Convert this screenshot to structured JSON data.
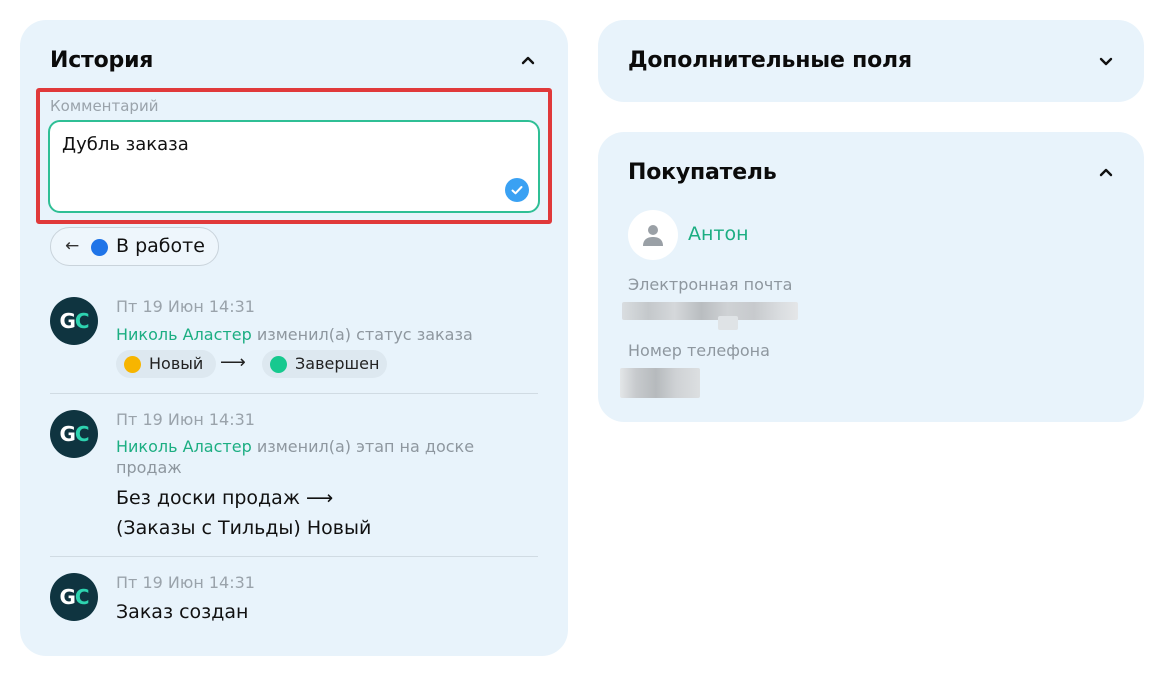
{
  "history": {
    "title": "История",
    "chevron_icon": "chevron-up-icon",
    "comment": {
      "label": "Комментарий",
      "value": "Дубль заказа",
      "send_icon": "check-circle-icon"
    },
    "status": {
      "back_arrow": "←",
      "label": "В работе",
      "color": "#1f74e8"
    },
    "entries": [
      {
        "time": "Пт 19 Июн 14:31",
        "user": "Николь Аластер",
        "action": "изменил(а) статус заказа",
        "from": {
          "label": "Новый",
          "color": "#f7b500"
        },
        "arrow": "⟶",
        "to": {
          "label": "Завершен",
          "color": "#17c98f"
        }
      },
      {
        "time": "Пт 19 Июн 14:31",
        "user": "Николь Аластер",
        "action": "изменил(а) этап на доске продаж",
        "line1": "Без доски продаж ⟶",
        "line2": "(Заказы с Тильды) Новый"
      },
      {
        "time": "Пт 19 Июн 14:31",
        "text": "Заказ создан"
      }
    ],
    "avatar": {
      "letter1": "G",
      "letter2": "C"
    }
  },
  "extra_fields": {
    "title": "Дополнительные поля",
    "chevron_icon": "chevron-down-icon"
  },
  "buyer": {
    "title": "Покупатель",
    "chevron_icon": "chevron-up-icon",
    "name": "Антон",
    "email_label": "Электронная почта",
    "phone_label": "Номер телефона"
  },
  "colors": {
    "accent_green": "#1cae82",
    "card_bg": "#e8f3fb",
    "highlight_red": "#e0393a",
    "status_blue": "#1f74e8"
  }
}
